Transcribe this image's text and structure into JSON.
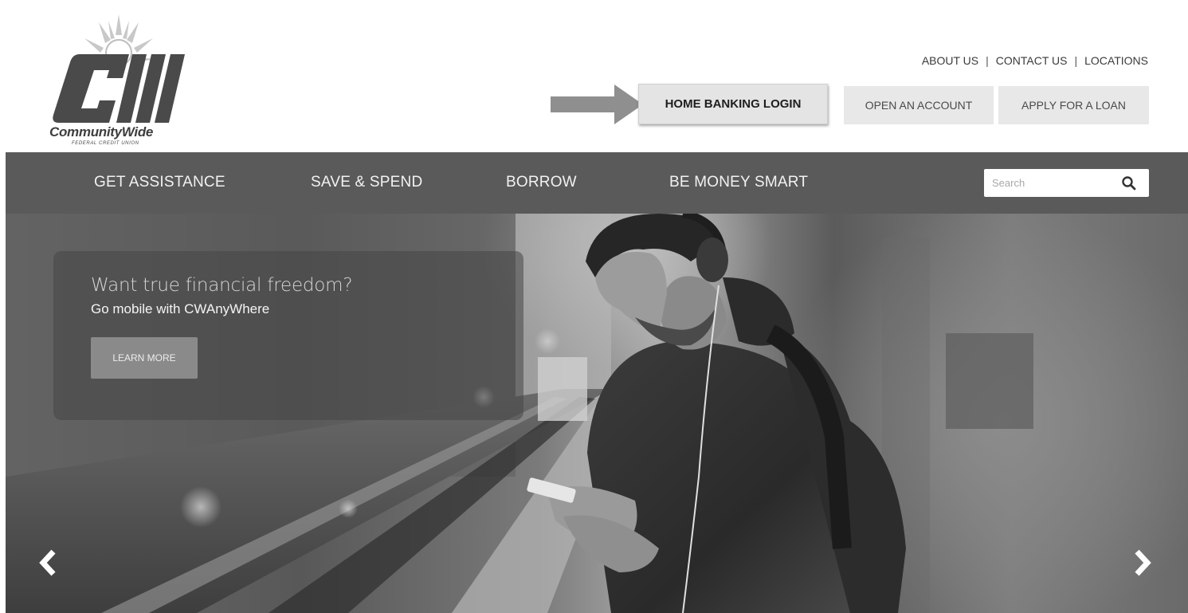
{
  "brand": {
    "name": "CommunityWide",
    "subtitle": "FEDERAL CREDIT UNION"
  },
  "utility_links": [
    "ABOUT US",
    "CONTACT US",
    "LOCATIONS"
  ],
  "header_buttons": {
    "login": "HOME BANKING LOGIN",
    "open_account": "OPEN AN ACCOUNT",
    "apply_loan": "APPLY FOR A LOAN"
  },
  "nav": {
    "items": [
      "GET ASSISTANCE",
      "SAVE & SPEND",
      "BORROW",
      "BE MONEY SMART"
    ]
  },
  "search": {
    "placeholder": "Search",
    "icon": "search-icon"
  },
  "hero": {
    "title": "Want true financial freedom?",
    "subtitle": "Go mobile with CWAnyWhere",
    "button": "LEARN MORE",
    "prev_icon": "chevron-left-icon",
    "next_icon": "chevron-right-icon"
  },
  "colors": {
    "nav_bar": "#5a5a5a",
    "button_bg": "#e8e8e8",
    "logo_gray": "#4a4a4a",
    "callout_arrow": "#8f8f8f"
  }
}
